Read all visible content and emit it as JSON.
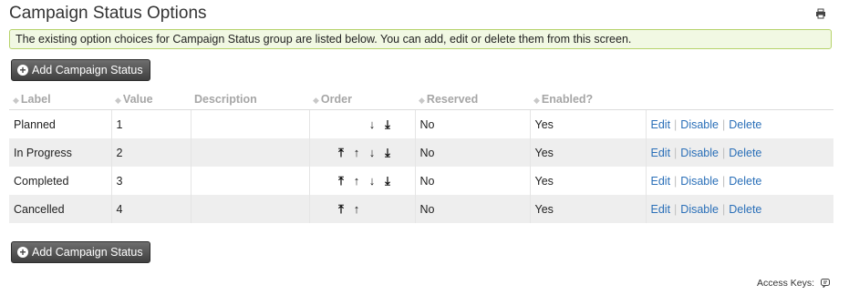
{
  "page": {
    "title": "Campaign Status Options",
    "notice": "The existing option choices for Campaign Status group are listed below. You can add, edit or delete them from this screen.",
    "add_button_label": "Add Campaign Status",
    "access_keys_label": "Access Keys:"
  },
  "table": {
    "columns": [
      "Label",
      "Value",
      "Description",
      "Order",
      "Reserved",
      "Enabled?"
    ],
    "rows": [
      {
        "label": "Planned",
        "value": "1",
        "description": "",
        "order": [
          "",
          "",
          "↓",
          "⤓"
        ],
        "reserved": "No",
        "enabled": "Yes",
        "actions": [
          "Edit",
          "Disable",
          "Delete"
        ]
      },
      {
        "label": "In Progress",
        "value": "2",
        "description": "",
        "order": [
          "⤒",
          "↑",
          "↓",
          "⤓"
        ],
        "reserved": "No",
        "enabled": "Yes",
        "actions": [
          "Edit",
          "Disable",
          "Delete"
        ]
      },
      {
        "label": "Completed",
        "value": "3",
        "description": "",
        "order": [
          "⤒",
          "↑",
          "↓",
          "⤓"
        ],
        "reserved": "No",
        "enabled": "Yes",
        "actions": [
          "Edit",
          "Disable",
          "Delete"
        ]
      },
      {
        "label": "Cancelled",
        "value": "4",
        "description": "",
        "order": [
          "⤒",
          "↑",
          "",
          ""
        ],
        "reserved": "No",
        "enabled": "Yes",
        "actions": [
          "Edit",
          "Disable",
          "Delete"
        ]
      }
    ]
  },
  "icons": {
    "print": "print-icon",
    "access_keys": "help-icon",
    "add": "plus-circle-icon",
    "sort": "sort-icon"
  },
  "colors": {
    "link": "#2a6fb8",
    "notice_bg": "#f1f8e3",
    "notice_border": "#b6d36b",
    "button_bg": "#4f4f4f"
  }
}
